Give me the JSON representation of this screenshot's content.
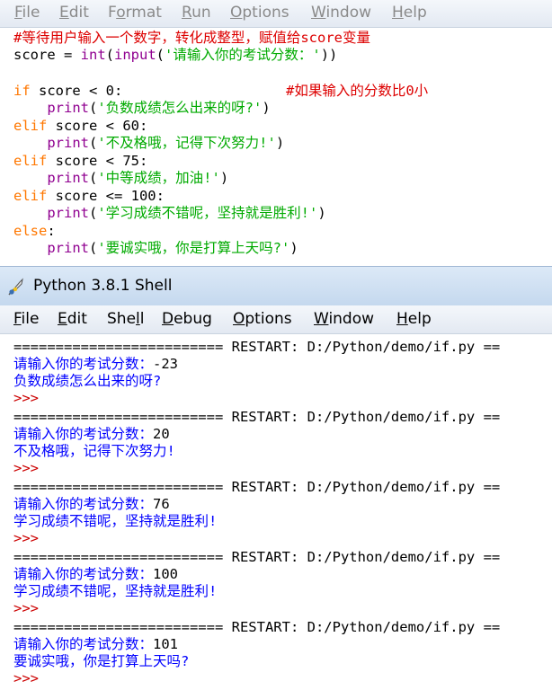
{
  "editor_menu": [
    {
      "pre": "",
      "u": "F",
      "post": "ile"
    },
    {
      "pre": "",
      "u": "E",
      "post": "dit"
    },
    {
      "pre": "F",
      "u": "o",
      "post": "rmat"
    },
    {
      "pre": "",
      "u": "R",
      "post": "un"
    },
    {
      "pre": "",
      "u": "O",
      "post": "ptions"
    },
    {
      "pre": "",
      "u": "W",
      "post": "indow"
    },
    {
      "pre": "",
      "u": "H",
      "post": "elp"
    }
  ],
  "code": {
    "l1": "#等待用户输入一个数字，转化成整型，赋值给score变量",
    "l2a": "score = ",
    "l2b": "int",
    "l2c": "(",
    "l2d": "input",
    "l2e": "(",
    "l2f": "'请输入你的考试分数：'",
    "l2g": "))",
    "l4a": "if",
    "l4b": " score < 0:",
    "l4c": "#如果输入的分数比0小",
    "l5a": "    ",
    "l5b": "print",
    "l5c": "(",
    "l5d": "'负数成绩怎么出来的呀?'",
    "l5e": ")",
    "l6a": "elif",
    "l6b": " score < 60:",
    "l7d": "'不及格哦，记得下次努力!'",
    "l8a": "elif",
    "l8b": " score < 75:",
    "l9d": "'中等成绩，加油!'",
    "l10a": "elif",
    "l10b": " score <= 100:",
    "l11d": "'学习成绩不错呢，坚持就是胜利!'",
    "l12a": "else",
    "l12b": ":",
    "l13d": "'要诚实哦，你是打算上天吗?'"
  },
  "shell_title": "Python 3.8.1 Shell",
  "shell_menu": [
    {
      "pre": "",
      "u": "F",
      "post": "ile"
    },
    {
      "pre": "",
      "u": "E",
      "post": "dit"
    },
    {
      "pre": "She",
      "u": "l",
      "post": "l"
    },
    {
      "pre": "",
      "u": "D",
      "post": "ebug"
    },
    {
      "pre": "",
      "u": "O",
      "post": "ptions"
    },
    {
      "pre": "",
      "u": "W",
      "post": "indow"
    },
    {
      "pre": "",
      "u": "H",
      "post": "elp"
    }
  ],
  "shell": {
    "restart": "========================= RESTART: D:/Python/demo/if.py ==",
    "prompt": ">>>",
    "runs": [
      {
        "ask": "请输入你的考试分数：",
        "input": "-23",
        "out": "负数成绩怎么出来的呀?"
      },
      {
        "ask": "请输入你的考试分数：",
        "input": "20",
        "out": "不及格哦，记得下次努力!"
      },
      {
        "ask": "请输入你的考试分数：",
        "input": "76",
        "out": "学习成绩不错呢，坚持就是胜利!"
      },
      {
        "ask": "请输入你的考试分数：",
        "input": "100",
        "out": "学习成绩不错呢，坚持就是胜利!"
      },
      {
        "ask": "请输入你的考试分数：",
        "input": "101",
        "out": "要诚实哦，你是打算上天吗?"
      }
    ]
  }
}
